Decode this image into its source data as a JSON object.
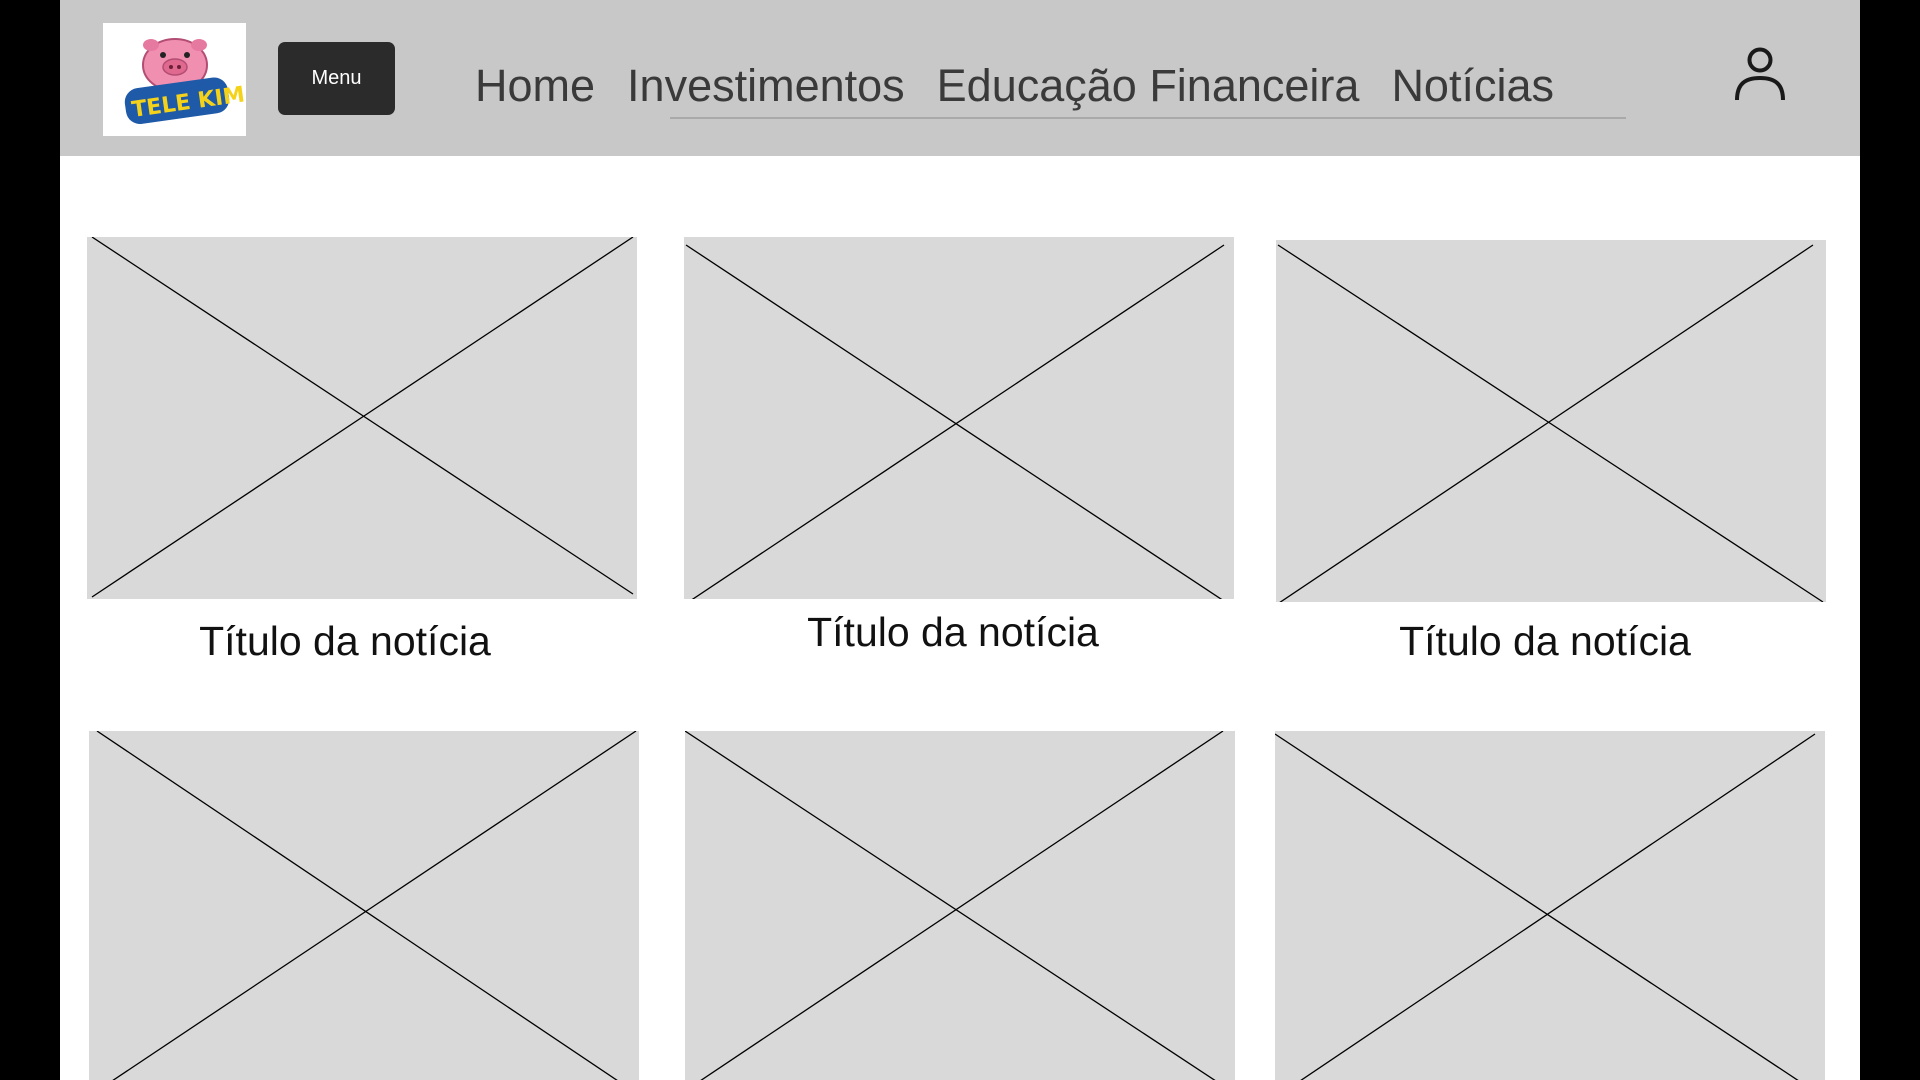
{
  "header": {
    "logo_text": "TELE KIM",
    "menu_label": "Menu",
    "nav": [
      "Home",
      "Investimentos",
      "Educação Financeira",
      "Notícias"
    ],
    "user_icon": "user-icon",
    "background": "#c8c8c8"
  },
  "news": {
    "cards": [
      {
        "title": "Título da notícia"
      },
      {
        "title": "Título da notícia"
      },
      {
        "title": "Título da notícia"
      },
      {
        "title": ""
      },
      {
        "title": ""
      },
      {
        "title": ""
      }
    ],
    "placeholder_color": "#d9d9d9"
  }
}
